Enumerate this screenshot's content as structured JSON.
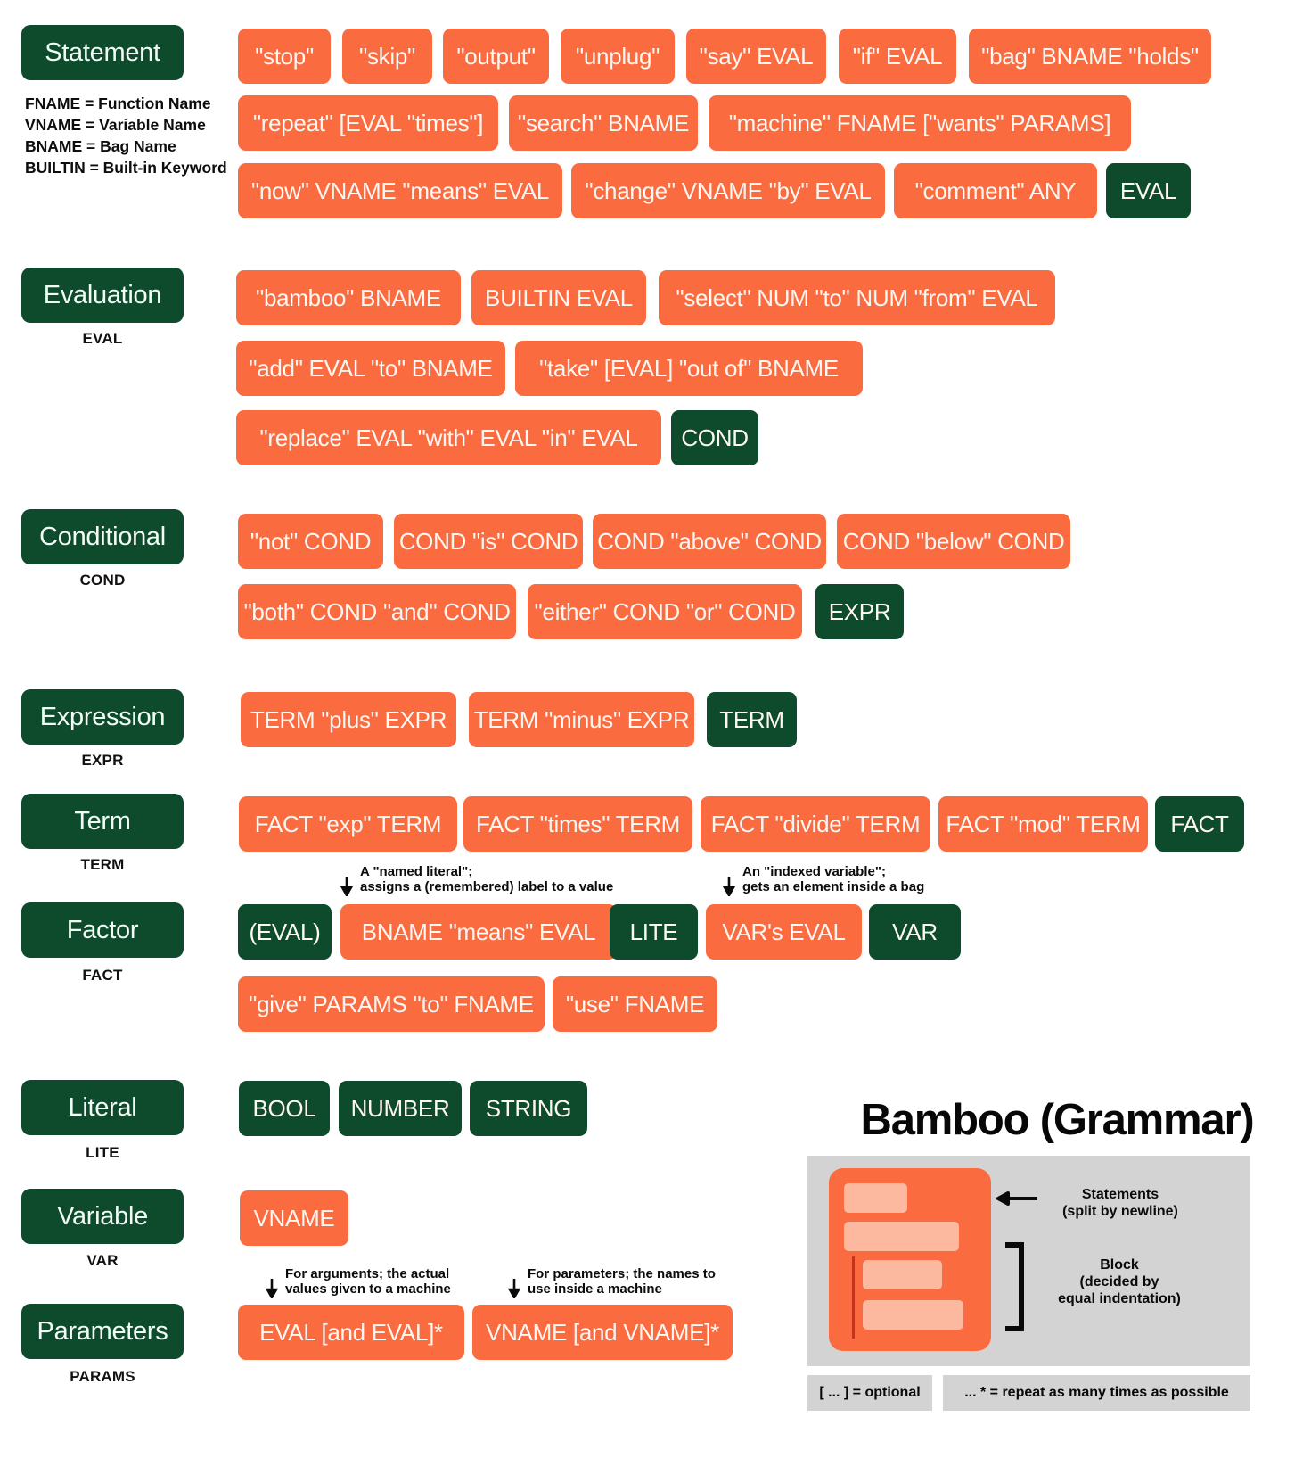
{
  "legend_definitions": [
    "FNAME = Function Name",
    "VNAME = Variable Name",
    "BNAME = Bag Name",
    "BUILTIN = Built-in Keyword"
  ],
  "colors": {
    "green": "#0d4b2c",
    "orange": "#fb6b40",
    "orange_light": "#fcb9a0",
    "gray": "#d3d3d3",
    "text_light": "#fdf6f1"
  },
  "sections": [
    {
      "name": "Statement",
      "abbr": "",
      "rules": [
        "\"stop\"",
        "\"skip\"",
        "\"output\"",
        "\"unplug\"",
        "\"say\" EVAL",
        "\"if\" EVAL",
        "\"bag\" BNAME \"holds\"",
        "\"repeat\" [EVAL \"times\"]",
        "\"search\" BNAME",
        "\"machine\" FNAME [\"wants\" PARAMS]",
        "\"now\" VNAME \"means\" EVAL",
        "\"change\" VNAME \"by\" EVAL",
        "\"comment\" ANY",
        "EVAL"
      ]
    },
    {
      "name": "Evaluation",
      "abbr": "EVAL",
      "rules": [
        "\"bamboo\" BNAME",
        "BUILTIN EVAL",
        "\"select\" NUM \"to\" NUM \"from\" EVAL",
        "\"add\" EVAL \"to\" BNAME",
        "\"take\" [EVAL] \"out of\" BNAME",
        "\"replace\" EVAL \"with\" EVAL \"in\" EVAL",
        "COND"
      ]
    },
    {
      "name": "Conditional",
      "abbr": "COND",
      "rules": [
        "\"not\" COND",
        "COND \"is\" COND",
        "COND \"above\" COND",
        "COND \"below\" COND",
        "\"both\" COND \"and\" COND",
        "\"either\" COND \"or\" COND",
        "EXPR"
      ]
    },
    {
      "name": "Expression",
      "abbr": "EXPR",
      "rules": [
        "TERM \"plus\" EXPR",
        "TERM \"minus\" EXPR",
        "TERM"
      ]
    },
    {
      "name": "Term",
      "abbr": "TERM",
      "rules": [
        "FACT \"exp\" TERM",
        "FACT \"times\" TERM",
        "FACT \"divide\" TERM",
        "FACT \"mod\" TERM",
        "FACT"
      ]
    },
    {
      "name": "Factor",
      "abbr": "FACT",
      "rules": [
        "(EVAL)",
        "BNAME \"means\" EVAL",
        "LITE",
        "VAR's EVAL",
        "VAR",
        "\"give\" PARAMS \"to\" FNAME",
        "\"use\" FNAME"
      ]
    },
    {
      "name": "Literal",
      "abbr": "LITE",
      "rules": [
        "BOOL",
        "NUMBER",
        "STRING"
      ]
    },
    {
      "name": "Variable",
      "abbr": "VAR",
      "rules": [
        "VNAME"
      ]
    },
    {
      "name": "Parameters",
      "abbr": "PARAMS",
      "rules": [
        "EVAL [and EVAL]*",
        "VNAME [and VNAME]*"
      ]
    }
  ],
  "annotations": {
    "named_literal_l1": "A \"named literal\";",
    "named_literal_l2": "assigns a (remembered) label to a value",
    "indexed_variable_l1": "An \"indexed variable\";",
    "indexed_variable_l2": "gets an element inside a bag",
    "arguments_l1": "For arguments; the actual",
    "arguments_l2": "values given to a machine",
    "parameters_l1": "For parameters; the names to",
    "parameters_l2": "use inside a machine"
  },
  "panel": {
    "title": "Bamboo (Grammar)",
    "statements_l1": "Statements",
    "statements_l2": "(split by newline)",
    "block_l1": "Block",
    "block_l2": "(decided by",
    "block_l3": "equal indentation)",
    "legend_optional": "[ ... ] = optional",
    "legend_repeat": "... * = repeat as many times as possible"
  }
}
